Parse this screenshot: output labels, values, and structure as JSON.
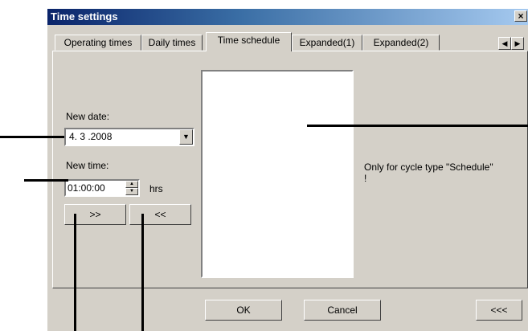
{
  "window": {
    "title": "Time settings",
    "close_glyph": "×"
  },
  "tabs": [
    {
      "label": "Operating times"
    },
    {
      "label": "Daily times"
    },
    {
      "label": "Time schedule"
    },
    {
      "label": "Expanded(1)"
    },
    {
      "label": "Expanded(2)"
    }
  ],
  "tab_scroll": {
    "left_icon": "◀",
    "right_icon": "▶"
  },
  "new_date": {
    "label": "New date:",
    "value": "4. 3 .2008",
    "dropdown_icon": "▼"
  },
  "new_time": {
    "label": "New time:",
    "value": "01:00:00",
    "unit": "hrs",
    "up_icon": "▲",
    "down_icon": "▼"
  },
  "buttons": {
    "add": ">>",
    "remove": "<<",
    "ok": "OK",
    "cancel": "Cancel",
    "collapse": "<<<"
  },
  "schedule_list": {
    "items": []
  },
  "note": {
    "line1": "Only for cycle type \"Schedule\"",
    "line2": "!"
  }
}
